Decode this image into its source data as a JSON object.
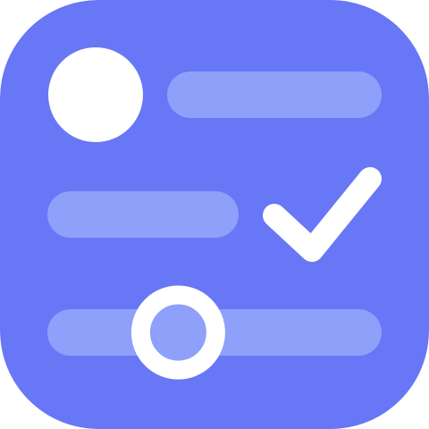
{
  "app_icon": {
    "name": "form-settings-app-icon",
    "colors": {
      "tile": "#6777F5",
      "bar": "#8FA0FA",
      "foreground": "#FFFFFF"
    },
    "elements": {
      "avatar": "avatar-circle-icon",
      "check": "checkmark-icon",
      "slider": "slider-icon"
    },
    "slider": {
      "level": 0.36
    }
  }
}
